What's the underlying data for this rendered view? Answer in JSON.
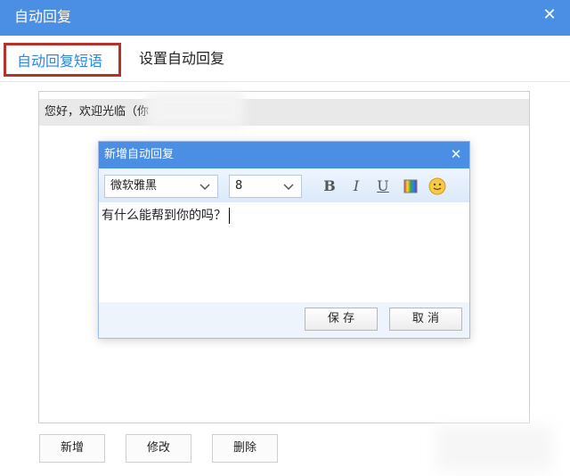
{
  "window": {
    "title": "自动回复"
  },
  "tabs": [
    {
      "label": "自动回复短语",
      "active": true
    },
    {
      "label": "设置自动回复",
      "active": false
    }
  ],
  "reply_list": [
    {
      "text": "您好，欢迎光临（你"
    }
  ],
  "buttons": {
    "add": "新增",
    "edit": "修改",
    "delete": "删除"
  },
  "dialog": {
    "title": "新增自动回复",
    "font_value": "微软雅黑",
    "size_value": "8",
    "bold_label": "B",
    "italic_label": "I",
    "underline_label": "U",
    "content": "有什么能帮到你的吗？",
    "save_label": "保 存",
    "cancel_label": "取 消"
  },
  "colors": {
    "titlebar": "#4a8fe3",
    "active_tab_text": "#2e86de",
    "highlight_border": "#b5322a"
  }
}
